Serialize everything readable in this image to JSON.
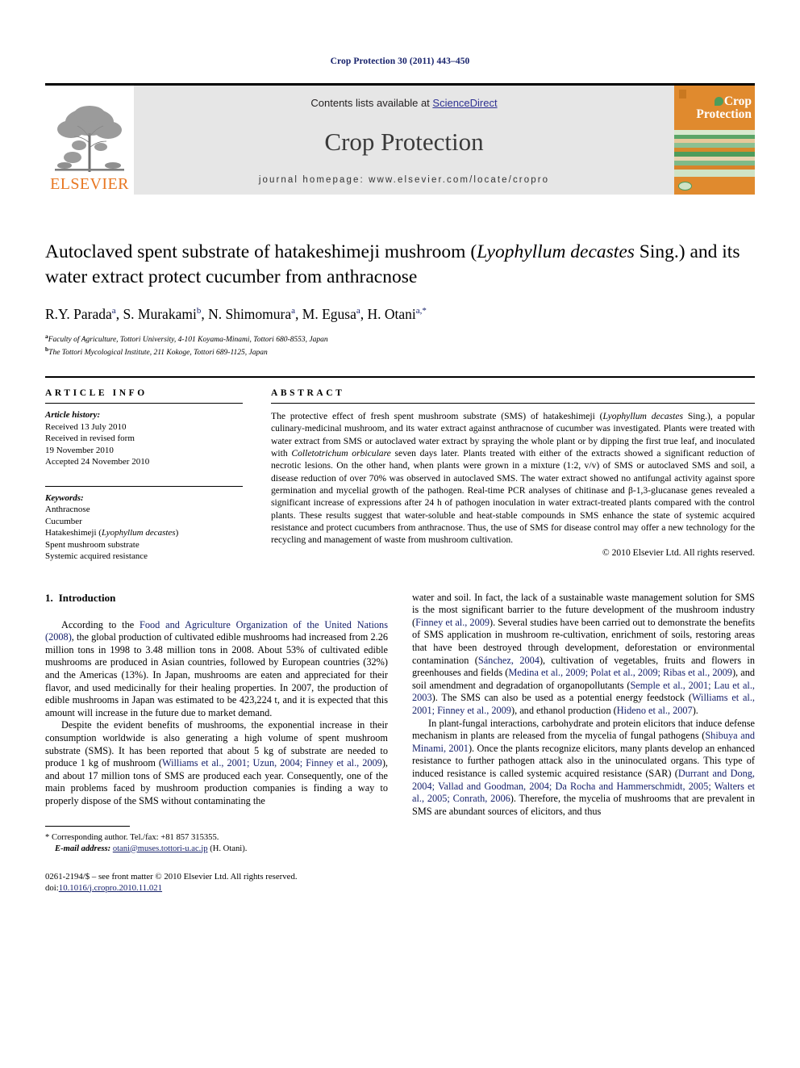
{
  "running_head": "Crop Protection 30 (2011) 443–450",
  "header": {
    "publisher_name": "ELSEVIER",
    "contents_prefix": "Contents lists available at ",
    "contents_link": "ScienceDirect",
    "journal_title": "Crop Protection",
    "homepage_line": "journal homepage: www.elsevier.com/locate/cropro",
    "cover_title_line1": "Crop",
    "cover_title_line2": "Protection",
    "accent_orange": "#e08a2e",
    "accent_green": "#4e9c5b",
    "link_blue": "#2e3192",
    "band_gray": "#e6e6e6"
  },
  "title": {
    "part1": "Autoclaved spent substrate of hatakeshimeji mushroom (",
    "italic1": "Lyophyllum decastes",
    "part2": " Sing.) and its water extract protect cucumber from anthracnose"
  },
  "authors": [
    {
      "name": "R.Y. Parada",
      "sup": "a"
    },
    {
      "name": "S. Murakami",
      "sup": "b"
    },
    {
      "name": "N. Shimomura",
      "sup": "a"
    },
    {
      "name": "M. Egusa",
      "sup": "a"
    },
    {
      "name": "H. Otani",
      "sup": "a,*"
    }
  ],
  "affiliations": [
    {
      "sup": "a",
      "text": "Faculty of Agriculture, Tottori University, 4-101 Koyama-Minami, Tottori 680-8553, Japan"
    },
    {
      "sup": "b",
      "text": "The Tottori Mycological Institute, 211 Kokoge, Tottori 689-1125, Japan"
    }
  ],
  "article_info": {
    "heading": "ARTICLE INFO",
    "history_label": "Article history:",
    "history_lines": [
      "Received 13 July 2010",
      "Received in revised form",
      "19 November 2010",
      "Accepted 24 November 2010"
    ],
    "keywords_label": "Keywords:",
    "keywords_plain": [
      "Anthracnose",
      "Cucumber"
    ],
    "keyword_italic_prefix": "Hatakeshimeji (",
    "keyword_italic_name": "Lyophyllum decastes",
    "keyword_italic_suffix": ")",
    "keywords_plain_tail": [
      "Spent mushroom substrate",
      "Systemic acquired resistance"
    ]
  },
  "abstract": {
    "heading": "ABSTRACT",
    "p1a": "The protective effect of fresh spent mushroom substrate (SMS) of hatakeshimeji (",
    "p1_it1": "Lyophyllum decastes",
    "p1b": " Sing.), a popular culinary-medicinal mushroom, and its water extract against anthracnose of cucumber was investigated. Plants were treated with water extract from SMS or autoclaved water extract by spraying the whole plant or by dipping the first true leaf, and inoculated with ",
    "p1_it2": "Colletotrichum orbiculare",
    "p1c": " seven days later. Plants treated with either of the extracts showed a significant reduction of necrotic lesions. On the other hand, when plants were grown in a mixture (1:2, v/v) of SMS or autoclaved SMS and soil, a disease reduction of over 70% was observed in autoclaved SMS. The water extract showed no antifungal activity against spore germination and mycelial growth of the pathogen. Real-time PCR analyses of chitinase and β-1,3-glucanase genes revealed a significant increase of expressions after 24 h of pathogen inoculation in water extract-treated plants compared with the control plants. These results suggest that water-soluble and heat-stable compounds in SMS enhance the state of systemic acquired resistance and protect cucumbers from anthracnose. Thus, the use of SMS for disease control may offer a new technology for the recycling and management of waste from mushroom cultivation.",
    "copyright": "© 2010 Elsevier Ltd. All rights reserved."
  },
  "body": {
    "section_number": "1.",
    "section_title": "Introduction",
    "left": {
      "p1_a": "According to the ",
      "p1_ref1": "Food and Agriculture Organization of the United Nations (2008)",
      "p1_b": ", the global production of cultivated edible mushrooms had increased from 2.26 million tons in 1998 to 3.48 million tons in 2008. About 53% of cultivated edible mushrooms are produced in Asian countries, followed by European countries (32%) and the Americas (13%). In Japan, mushrooms are eaten and appreciated for their flavor, and used medicinally for their healing properties. In 2007, the production of edible mushrooms in Japan was estimated to be 423,224 t, and it is expected that this amount will increase in the future due to market demand.",
      "p2_a": "Despite the evident benefits of mushrooms, the exponential increase in their consumption worldwide is also generating a high volume of spent mushroom substrate (SMS). It has been reported that about 5 kg of substrate are needed to produce 1 kg of mushroom (",
      "p2_ref1": "Williams et al., 2001; Uzun, 2004; Finney et al., 2009",
      "p2_b": "), and about 17 million tons of SMS are produced each year. Consequently, one of the main problems faced by mushroom production companies is finding a way to properly dispose of the SMS without contaminating the"
    },
    "right": {
      "p1_a": "water and soil. In fact, the lack of a sustainable waste management solution for SMS is the most significant barrier to the future development of the mushroom industry (",
      "p1_ref1": "Finney et al., 2009",
      "p1_b": "). Several studies have been carried out to demonstrate the benefits of SMS application in mushroom re-cultivation, enrichment of soils, restoring areas that have been destroyed through development, deforestation or environmental contamination (",
      "p1_ref2": "Sánchez, 2004",
      "p1_c": "), cultivation of vegetables, fruits and flowers in greenhouses and fields (",
      "p1_ref3": "Medina et al., 2009; Polat et al., 2009; Ribas et al., 2009",
      "p1_d": "), and soil amendment and degradation of organopollutants (",
      "p1_ref4": "Semple et al., 2001; Lau et al., 2003",
      "p1_e": "). The SMS can also be used as a potential energy feedstock (",
      "p1_ref5": "Williams et al., 2001; Finney et al., 2009",
      "p1_f": "), and ethanol production (",
      "p1_ref6": "Hideno et al., 2007",
      "p1_g": ").",
      "p2_a": "In plant-fungal interactions, carbohydrate and protein elicitors that induce defense mechanism in plants are released from the mycelia of fungal pathogens (",
      "p2_ref1": "Shibuya and Minami, 2001",
      "p2_b": "). Once the plants recognize elicitors, many plants develop an enhanced resistance to further pathogen attack also in the uninoculated organs. This type of induced resistance is called systemic acquired resistance (SAR) (",
      "p2_ref2": "Durrant and Dong, 2004; Vallad and Goodman, 2004; Da Rocha and Hammerschmidt, 2005; Walters et al., 2005; Conrath, 2006",
      "p2_c": "). Therefore, the mycelia of mushrooms that are prevalent in SMS are abundant sources of elicitors, and thus"
    }
  },
  "footnote": {
    "corresponding": "* Corresponding author. Tel./fax: +81 857 315355.",
    "email_label": "E-mail address:",
    "email": "otani@muses.tottori-u.ac.jp",
    "email_attrib": "(H. Otani).",
    "imprint_line": "0261-2194/$ – see front matter © 2010 Elsevier Ltd. All rights reserved.",
    "doi_label": "doi:",
    "doi_value": "10.1016/j.cropro.2010.11.021"
  }
}
